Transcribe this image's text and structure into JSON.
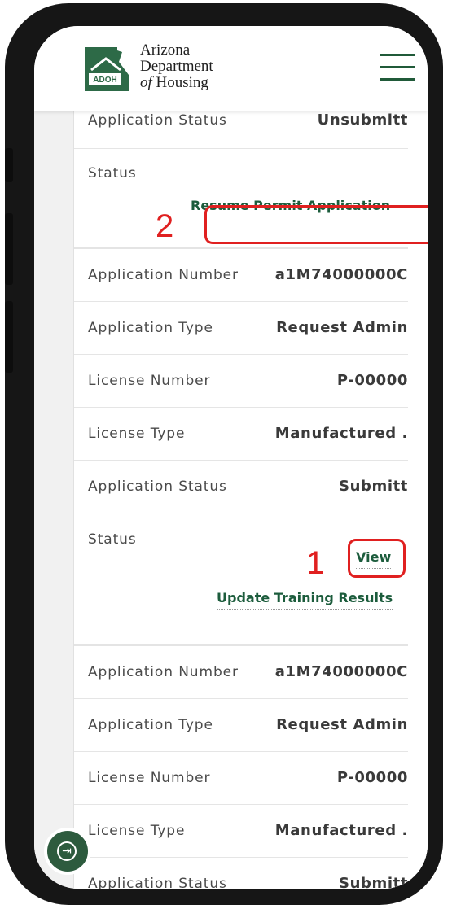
{
  "header": {
    "logo_badge": "ADOH",
    "logo_line1": "Arizona",
    "logo_line2": "Department",
    "logo_line3_italic": "of",
    "logo_line3": " Housing",
    "menu_icon": "hamburger-menu-icon"
  },
  "record_top": {
    "application_status_label": "Application Status",
    "application_status_value": "Unsubmitt",
    "status_label": "Status",
    "resume_link": "Resume Permit Application"
  },
  "record_middle": {
    "application_number_label": "Application Number",
    "application_number_value": "a1M74000000C",
    "application_type_label": "Application Type",
    "application_type_value": "Request Admin",
    "license_number_label": "License Number",
    "license_number_value": "P-00000",
    "license_type_label": "License Type",
    "license_type_value": "Manufactured .",
    "application_status_label": "Application Status",
    "application_status_value": "Submitt",
    "status_label": "Status",
    "view_link": "View",
    "update_link": "Update Training Results"
  },
  "record_bottom": {
    "application_number_label": "Application Number",
    "application_number_value": "a1M74000000C",
    "application_type_label": "Application Type",
    "application_type_value": "Request Admin",
    "license_number_label": "License Number",
    "license_number_value": "P-00000",
    "license_type_label": "License Type",
    "license_type_value": "Manufactured .",
    "application_status_label": "Application Status",
    "application_status_value": "Submitt"
  },
  "annotations": {
    "step1": "1",
    "step2": "2",
    "color": "#e02020"
  },
  "colors": {
    "brand_green": "#1c5c3c",
    "fab_green": "#2d5b3e"
  },
  "fab": {
    "icon": "arrow-into-circle-icon",
    "glyph": "⇥"
  }
}
